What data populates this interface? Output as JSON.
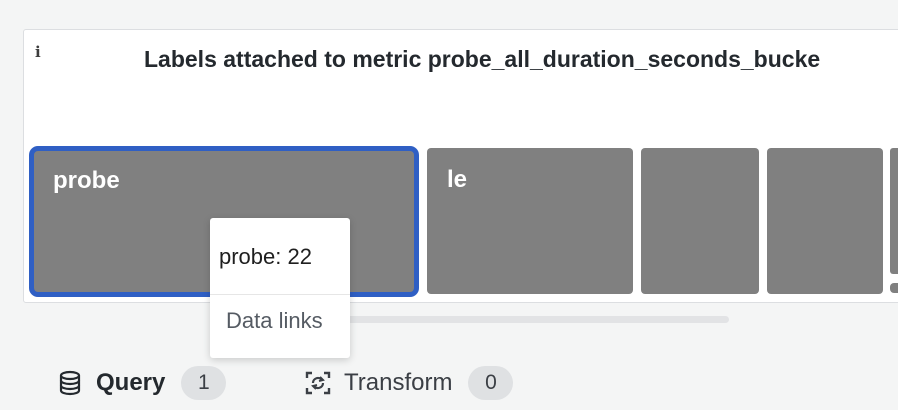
{
  "panel": {
    "info_icon": "info-icon",
    "title": "Labels attached to metric probe_all_duration_seconds_bucke",
    "tiles": [
      {
        "label": "probe",
        "selected": true
      },
      {
        "label": "le",
        "selected": false
      },
      {
        "label": "",
        "selected": false
      },
      {
        "label": "",
        "selected": false
      }
    ]
  },
  "tooltip": {
    "value": "probe: 22",
    "data_links_label": "Data links"
  },
  "tabs": {
    "query": {
      "icon": "database-icon",
      "label": "Query",
      "count": "1"
    },
    "transform": {
      "icon": "transform-icon",
      "label": "Transform",
      "count": "0"
    }
  },
  "colors": {
    "tile": "#808080",
    "selected_border": "#2f5fc4",
    "badge": "#dfe1e3"
  }
}
